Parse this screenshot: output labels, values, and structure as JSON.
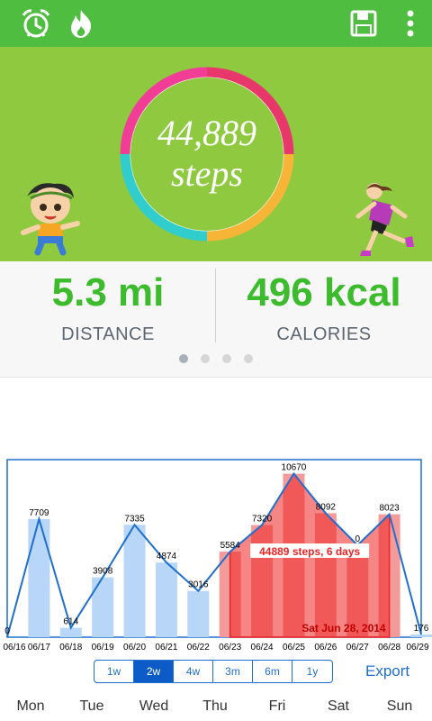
{
  "toolbar": {
    "bg": "#4fbd3f",
    "icons": [
      "alarm-clock-icon",
      "flame-icon",
      "save-icon",
      "overflow-menu-icon"
    ]
  },
  "hero": {
    "bg": "#8fc940",
    "steps_value": "44,889",
    "steps_unit": "steps"
  },
  "stats": {
    "distance_value": "5.3 mi",
    "distance_label": "DISTANCE",
    "calories_value": "496 kcal",
    "calories_label": "CALORIES",
    "pager_count": 4,
    "pager_active": 0
  },
  "chart_data": {
    "type": "bar",
    "categories": [
      "06/16",
      "06/17",
      "06/18",
      "06/19",
      "06/20",
      "06/21",
      "06/22",
      "06/23",
      "06/24",
      "06/25",
      "06/26",
      "06/27",
      "06/28",
      "06/29"
    ],
    "values": [
      0,
      7709,
      614,
      3908,
      7335,
      4874,
      3016,
      5584,
      7320,
      10670,
      8092,
      6000,
      8023,
      176
    ],
    "value_labels": [
      "0",
      "7709",
      "614",
      "3908",
      "7335",
      "4874",
      "3016",
      "5584",
      "7320",
      "10670",
      "8092",
      "0",
      "8023",
      "176"
    ],
    "selected_range": [
      7,
      12
    ],
    "selection_label": "44889 steps, 6 days",
    "selection_date": "Sat Jun 28, 2014",
    "ylim": [
      0,
      11000
    ],
    "colors": {
      "bar": "#b8d6f8",
      "selected_bar": "#f39b9b",
      "line": "#1f6fd0",
      "selection": "#ee2222"
    },
    "weekdays": [
      "Mon",
      "Tue",
      "Wed",
      "Thu",
      "Fri",
      "Sat",
      "Sun"
    ]
  },
  "range": {
    "options": [
      "1w",
      "2w",
      "4w",
      "3m",
      "6m",
      "1y"
    ],
    "selected": "2w",
    "export_label": "Export"
  }
}
